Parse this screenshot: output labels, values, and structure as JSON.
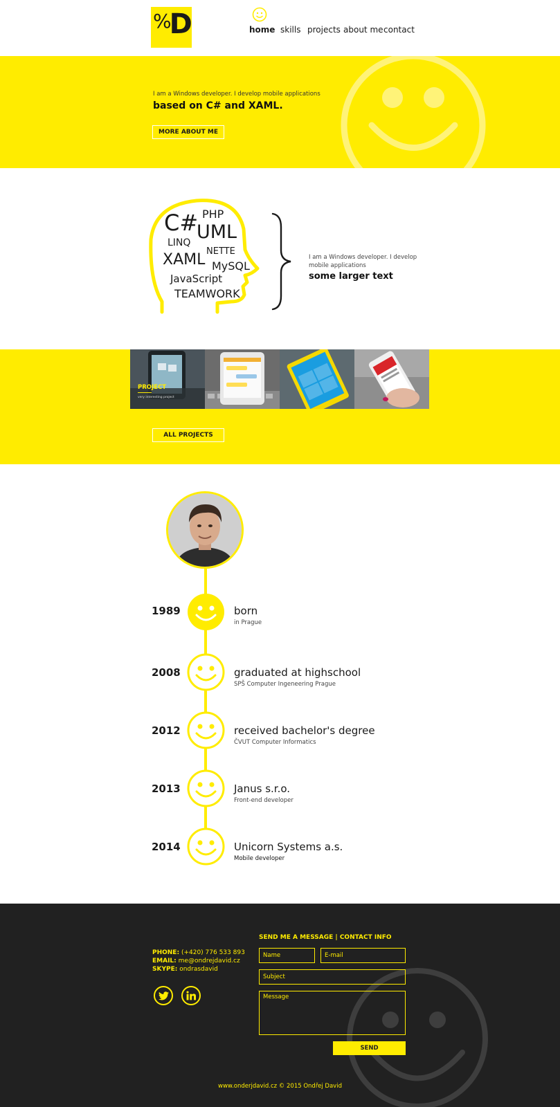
{
  "colors": {
    "accent": "#ffec00",
    "dark": "#212121",
    "text": "#1a1a1a"
  },
  "logo": {
    "pct": "%",
    "letter": "D"
  },
  "nav": {
    "items": [
      {
        "label": "home",
        "active": true
      },
      {
        "label": "skills"
      },
      {
        "label": "projects"
      },
      {
        "label": "about me"
      },
      {
        "label": "contact"
      }
    ]
  },
  "hero": {
    "small_text": "I am a Windows developer. I develop mobile applications",
    "big_text": "based on C# and XAML.",
    "button_label": "MORE ABOUT ME"
  },
  "skills": {
    "words": [
      "C#",
      "PHP",
      "UML",
      "LINQ",
      "NETTE",
      "XAML",
      "MySQL",
      "JavaScript",
      "TEAMWORK"
    ],
    "small_text": "I am a Windows developer. I develop mobile applications",
    "big_text": "some larger text"
  },
  "projects": {
    "tiles": [
      {
        "title": "PROJECT",
        "caption": "very interesting project",
        "icon": "phone-app-image"
      },
      {
        "icon": "chat-app-image"
      },
      {
        "icon": "windows-phone-tiles-image"
      },
      {
        "icon": "hand-phone-image"
      }
    ],
    "button_label": "ALL PROJECTS"
  },
  "timeline": {
    "avatar": "profile-photo",
    "events": [
      {
        "year": "1989",
        "title": "born",
        "subtitle": "in Prague"
      },
      {
        "year": "2008",
        "title": "graduated at highschool",
        "subtitle": "SPŠ Computer Ingeneering Prague"
      },
      {
        "year": "2012",
        "title": "received bachelor's degree",
        "subtitle": "ČVUT Computer Informatics"
      },
      {
        "year": "2013",
        "title": "Janus s.r.o.",
        "subtitle": "Front-end developer"
      },
      {
        "year": "2014",
        "title": "Unicorn Systems a.s.",
        "subtitle": "Mobile developer"
      }
    ]
  },
  "footer": {
    "phone_label": "PHONE:",
    "phone": "(+420) 776 533 893",
    "email_label": "EMAIL:",
    "email": "me@ondrejdavid.cz",
    "skype_label": "SKYPE:",
    "skype": "ondrasdavid",
    "social": [
      "twitter-icon",
      "linkedin-icon"
    ],
    "form_title": "SEND ME A MESSAGE | CONTACT INFO",
    "name_placeholder": "Name",
    "email_placeholder": "E-mail",
    "subject_placeholder": "Subject",
    "message_placeholder": "Message",
    "send_label": "SEND",
    "copyright": "www.onderjdavid.cz © 2015 Ondřej David"
  }
}
